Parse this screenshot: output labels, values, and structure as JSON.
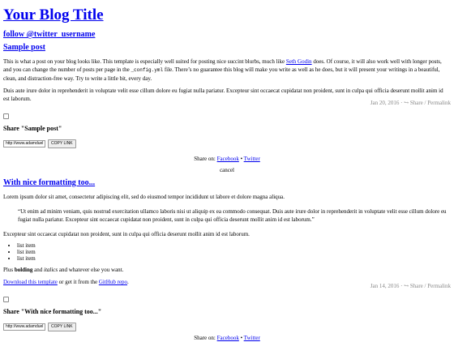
{
  "blog": {
    "title": "Your Blog Title",
    "follow": "follow @twitter_username"
  },
  "post1": {
    "title": "Sample post",
    "p1": {
      "before_link": "This is what a post on your blog looks like. This template is especially well suited for posting nice succint blurbs, much like ",
      "link": "Seth Godin",
      "after_link": " does. Of course, it will also work well with longer posts, and you can change the number of posts per page in the ",
      "code": "_config.yml",
      "after_code": " file. There’s no guarantee this blog will make you write as well as he does, but it will present your writings in a beautiful, clean, and distraction-free way. Try to write a little bit, every day."
    },
    "p2": "Duis aute irure dolor in reprehenderit in voluptate velit esse cillum dolore eu fugiat nulla pariatur. Excepteur sint occaecat cupidatat non proident, sunt in culpa qui officia deserunt mollit anim id est laborum.",
    "date": "Jan 20, 2016",
    "share_label": "Share",
    "permalink": "Permalink",
    "share_heading": "Share \"Sample post\"",
    "share_url": "http://www.adamduel",
    "copy_link": "COPY LINK",
    "share_on": "Share on: ",
    "facebook": "Facebook",
    "twitter": "Twitter",
    "cancel": "cancel"
  },
  "post2": {
    "title": "With nice formatting too...",
    "p1": "Lorem ipsum dolor sit amet, consectetur adipiscing elit, sed do eiusmod tempor incididunt ut labore et dolore magna aliqua.",
    "quote": "“Ut enim ad minim veniam, quis nostrud exercitation ullamco laboris nisi ut aliquip ex ea commodo consequat. Duis aute irure dolor in reprehenderit in voluptate velit esse cillum dolore eu fugiat nulla pariatur. Excepteur sint occaecat cupidatat non proident, sunt in culpa qui officia deserunt mollit anim id est laborum.”",
    "p2": "Excepteur sint occaecat cupidatat non proident, sunt in culpa qui officia deserunt mollit anim id est laborum.",
    "list": [
      "list item",
      "list item",
      "list item"
    ],
    "plus": "Plus ",
    "bolding": "bolding",
    "and": " and ",
    "italics": "italics",
    "rest": " and whatever else you want.",
    "download_link": "Download this template",
    "or_get": " or get it from the ",
    "github_link": "GitHub repo",
    "period": ".",
    "date": "Jan 14, 2016",
    "share_label": "Share",
    "permalink": "Permalink",
    "share_heading": "Share \"With nice formatting too...\"",
    "share_url": "http://www.adamduel",
    "copy_link": "COPY LINK",
    "share_on": "Share on: ",
    "facebook": "Facebook",
    "twitter": "Twitter"
  },
  "icons": {
    "share_arrow": "↪"
  }
}
